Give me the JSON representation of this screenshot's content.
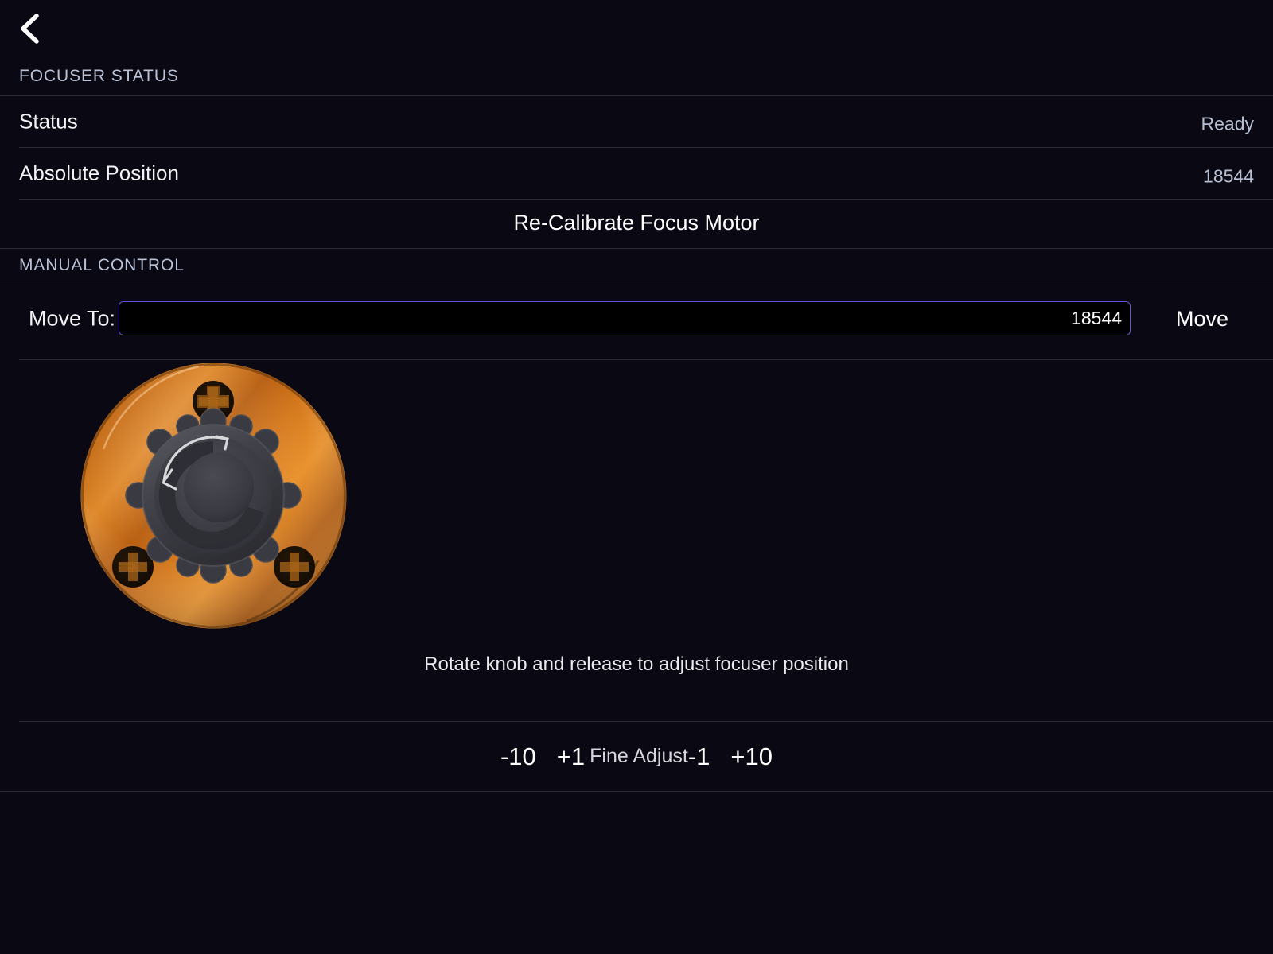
{
  "navbar": {
    "back_icon": "chevron-left-icon",
    "back_label": ""
  },
  "sections": {
    "focuser_status": {
      "header": "FOCUSER STATUS",
      "rows": [
        {
          "label": "Status",
          "value": "Ready"
        },
        {
          "label": "Absolute Position",
          "value": "18544"
        }
      ],
      "action": {
        "label": "Re-Calibrate Focus Motor"
      }
    },
    "manual_control": {
      "header": "MANUAL CONTROL",
      "move_to": {
        "label": "Move To:",
        "value": "18544",
        "placeholder": "18544",
        "button_label": "Move"
      },
      "knob": {
        "icon": "focuser-knob-dial",
        "disc_color": "#d9741b",
        "knob_color": "#3a3a40",
        "hint": "Rotate knob and release to adjust focuser position"
      },
      "fine_adjust": {
        "minus_ten": "-10",
        "plus_one": "+1",
        "label": "Fine Adjust",
        "minus_one": "-1",
        "plus_ten": "+10"
      }
    }
  },
  "theme": {
    "background": "#0a0812",
    "divider": "#2a2a38",
    "accent_border": "#6b4fd8",
    "header_text": "#b9c2d6",
    "value_text": "#b6bfd2"
  }
}
